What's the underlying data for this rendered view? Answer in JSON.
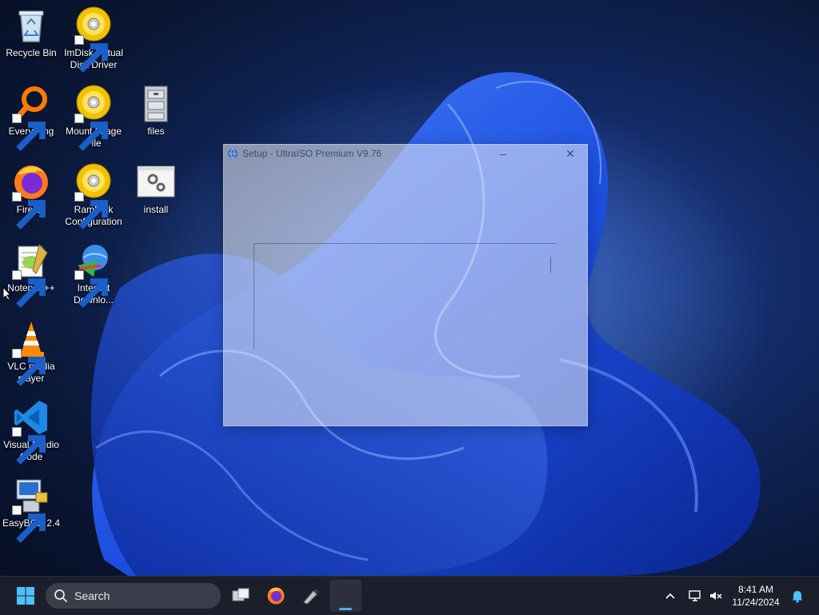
{
  "desktop": {
    "icons": [
      {
        "label": "Recycle Bin",
        "icon": "recycle-bin-icon"
      },
      {
        "label": "ImDisk Virtual Disk Driver",
        "icon": "disc-icon"
      },
      {
        "label": "Everything",
        "icon": "magnifier-icon"
      },
      {
        "label": "Mount Image File",
        "icon": "disc-icon"
      },
      {
        "label": "files",
        "icon": "file-cabinet-icon"
      },
      {
        "label": "Firefox",
        "icon": "firefox-icon"
      },
      {
        "label": "RamDisk Configuration",
        "icon": "disc-icon"
      },
      {
        "label": "install",
        "icon": "settings-window-icon"
      },
      {
        "label": "Notepad++",
        "icon": "notepadpp-icon"
      },
      {
        "label": "Internet Downlo...",
        "icon": "idm-icon"
      },
      {
        "label": "VLC media player",
        "icon": "vlc-cone-icon"
      },
      {
        "label": "Visual Studio Code",
        "icon": "vscode-icon"
      },
      {
        "label": "EasyBCD 2.4",
        "icon": "easybcd-icon"
      }
    ]
  },
  "setup_window": {
    "title": "Setup - UltraISO Premium V9.76",
    "minimize_label": "–",
    "close_label": "✕"
  },
  "taskbar": {
    "search_placeholder": "Search",
    "pinned": [
      "task-view",
      "firefox",
      "usb-tool",
      "setup-window"
    ]
  },
  "tray": {
    "time": "8:41 AM",
    "date": "11/24/2024"
  },
  "colors": {
    "accent": "#5aa8ea",
    "taskbar": "#1c202c",
    "wallpaper_blue": "#1e56e0"
  }
}
